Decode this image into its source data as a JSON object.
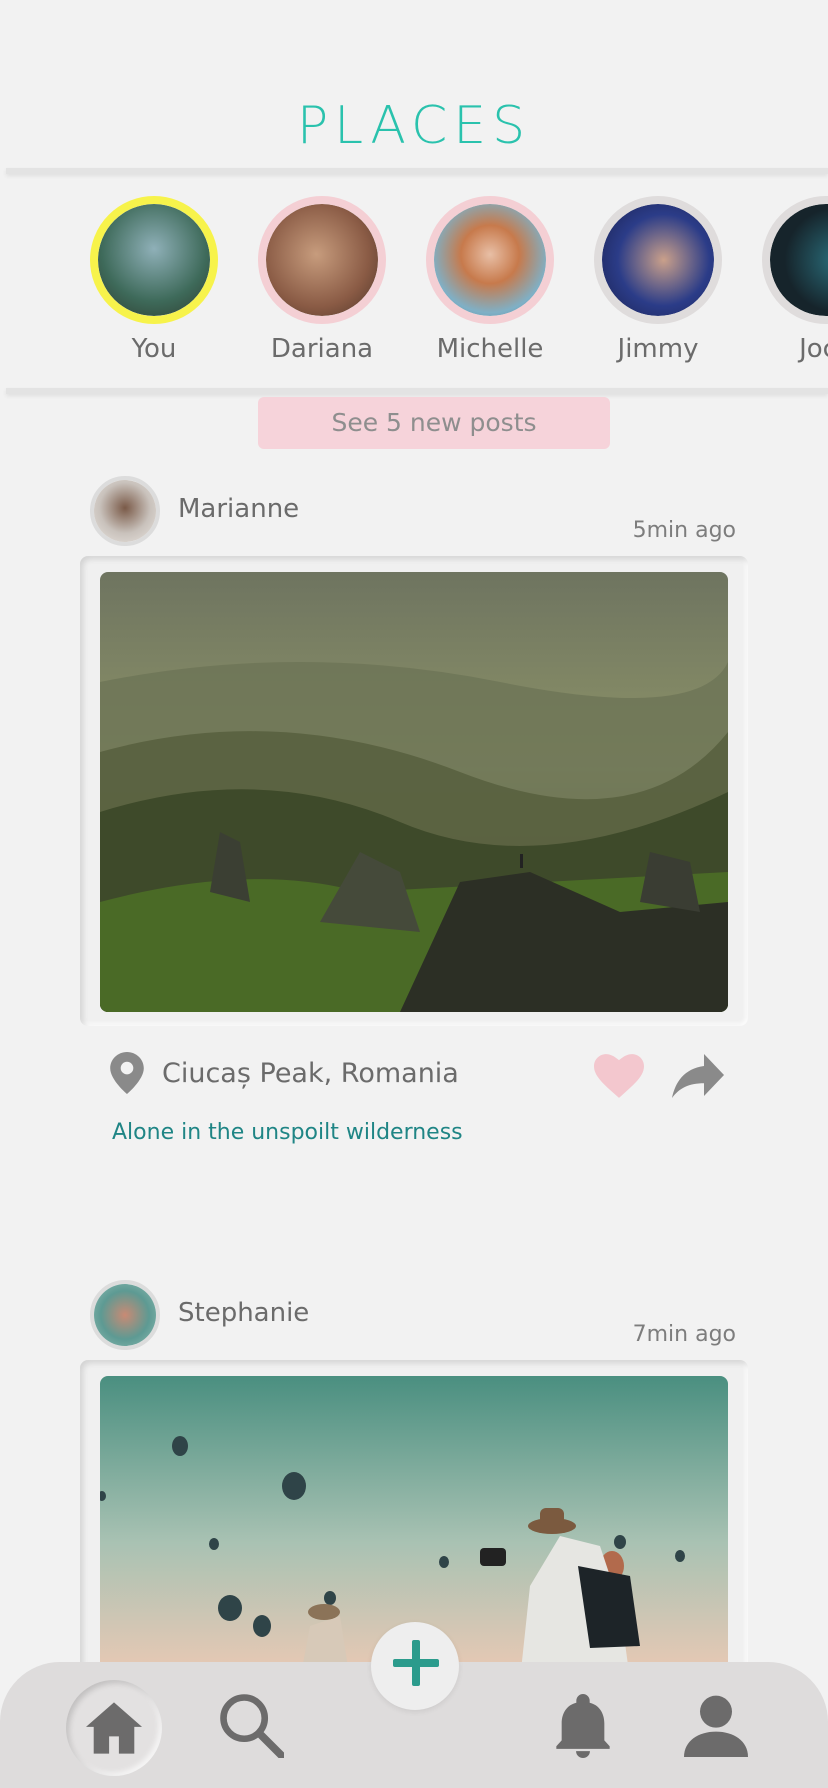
{
  "app": {
    "logo": "PLACES",
    "accent_color": "#2ac2ad"
  },
  "stories": [
    {
      "name": "You",
      "ring_color": "#f7f34b"
    },
    {
      "name": "Dariana",
      "ring_color": "#f4cfd4"
    },
    {
      "name": "Michelle",
      "ring_color": "#f4cfd4"
    },
    {
      "name": "Jimmy",
      "ring_color": "#dfdcdc"
    },
    {
      "name": "Joce",
      "ring_color": "#dfdcdc"
    }
  ],
  "feed": {
    "new_posts_label": "See 5 new posts",
    "posts": [
      {
        "author": "Marianne",
        "time": "5min ago",
        "location": "Ciucaș Peak, Romania",
        "caption": "Alone in the unspoilt wilderness",
        "liked": true
      },
      {
        "author": "Stephanie",
        "time": "7min ago"
      }
    ]
  },
  "tabbar": {
    "items": [
      "home-icon",
      "search-icon",
      "add-icon",
      "bell-icon",
      "profile-icon"
    ],
    "active": "home-icon"
  }
}
